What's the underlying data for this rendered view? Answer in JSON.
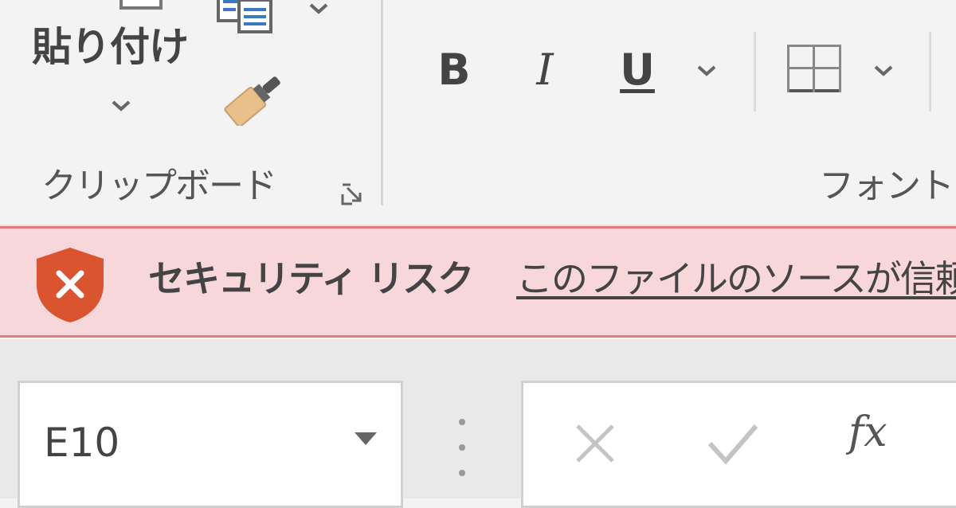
{
  "ribbon": {
    "clipboard": {
      "paste_label": "貼り付け",
      "group_label": "クリップボード"
    },
    "font": {
      "bold_label": "B",
      "italic_label": "I",
      "underline_label": "U",
      "group_label": "フォント"
    },
    "icons": [
      "paste-icon",
      "copy-icon",
      "format-painter-icon",
      "dialog-launcher-icon",
      "borders-icon",
      "chevron-down-icon"
    ]
  },
  "security_bar": {
    "title": "セキュリティ リスク",
    "message": "このファイルのソースが信頼",
    "icon": "shield-x-icon",
    "colors": {
      "background": "#f8d7da",
      "border": "#e07b80",
      "shield": "#d9542f"
    }
  },
  "formula_bar": {
    "name_box_value": "E10",
    "function_label": "fx",
    "icons": [
      "cancel-icon",
      "enter-icon",
      "insert-function-icon"
    ]
  }
}
